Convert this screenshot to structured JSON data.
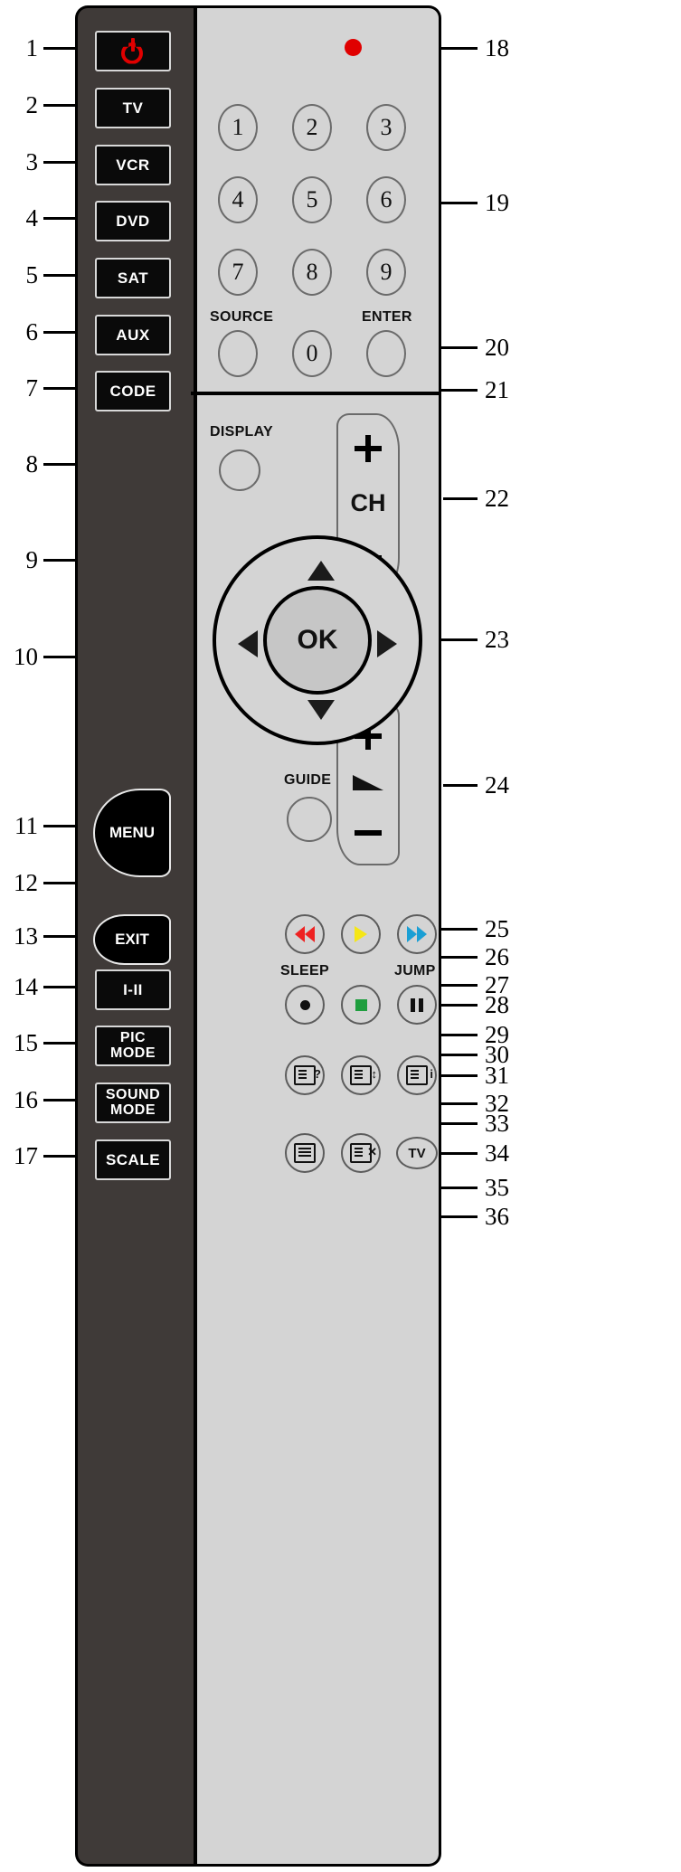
{
  "diagram": {
    "title": "Universal remote control button reference diagram",
    "callout_numbers": [
      "1",
      "2",
      "3",
      "4",
      "5",
      "6",
      "7",
      "8",
      "9",
      "10",
      "11",
      "12",
      "13",
      "14",
      "15",
      "16",
      "17",
      "18",
      "19",
      "20",
      "21",
      "22",
      "23",
      "24",
      "25",
      "26",
      "27",
      "28",
      "29",
      "30",
      "31",
      "32",
      "33",
      "34",
      "35",
      "36"
    ]
  },
  "left_column_buttons": [
    {
      "n": "1",
      "label": "",
      "icon": "power-icon"
    },
    {
      "n": "2",
      "label": "TV",
      "icon": ""
    },
    {
      "n": "3",
      "label": "VCR",
      "icon": ""
    },
    {
      "n": "4",
      "label": "DVD",
      "icon": ""
    },
    {
      "n": "5",
      "label": "SAT",
      "icon": ""
    },
    {
      "n": "6",
      "label": "AUX",
      "icon": ""
    },
    {
      "n": "7",
      "label": "CODE",
      "icon": ""
    },
    {
      "n": "11",
      "label": "MENU",
      "icon": ""
    },
    {
      "n": "13",
      "label": "EXIT",
      "icon": ""
    },
    {
      "n": "14",
      "label": "I-II",
      "icon": ""
    },
    {
      "n": "15",
      "label": "PIC MODE",
      "line1": "PIC",
      "line2": "MODE",
      "icon": ""
    },
    {
      "n": "16",
      "label": "SOUND MODE",
      "line1": "SOUND",
      "line2": "MODE",
      "icon": ""
    },
    {
      "n": "17",
      "label": "SCALE",
      "icon": ""
    }
  ],
  "keypad": {
    "digits": [
      "1",
      "2",
      "3",
      "4",
      "5",
      "6",
      "7",
      "8",
      "9",
      "0"
    ],
    "source_label": "SOURCE",
    "enter_label": "ENTER"
  },
  "face_labels": {
    "display": "DISPLAY",
    "guide": "GUIDE",
    "sleep": "SLEEP",
    "jump": "JUMP",
    "ok": "OK",
    "ch": "CH",
    "tv": "TV"
  },
  "colors": {
    "led_red": "#e00000",
    "power_red": "#e00000",
    "rewind_red": "#ee2222",
    "play_yellow": "#f5e617",
    "forward_blue": "#1a9fd4",
    "stop_green": "#1f9e3e",
    "body_light": "#d4d4d4",
    "body_dark": "#3f3a38",
    "key_black": "#0a0a0a"
  },
  "icons": {
    "n1": "power-icon",
    "n9": "arrow-up-icon",
    "n10": "ok-button",
    "n18": "ir-led-indicator",
    "n23": "mute-icon",
    "n24": "volume-rocker",
    "n25": "fast-forward-icon",
    "n26": "play-icon",
    "n27": "rewind-icon",
    "n28": "pause-icon",
    "n29": "stop-icon",
    "n30": "record-icon",
    "n31": "teletext-index-icon",
    "n32": "teletext-size-icon",
    "n33": "teletext-reveal-icon",
    "n34": "teletext-tv-icon",
    "n35": "teletext-cancel-icon",
    "n36": "teletext-icon"
  }
}
